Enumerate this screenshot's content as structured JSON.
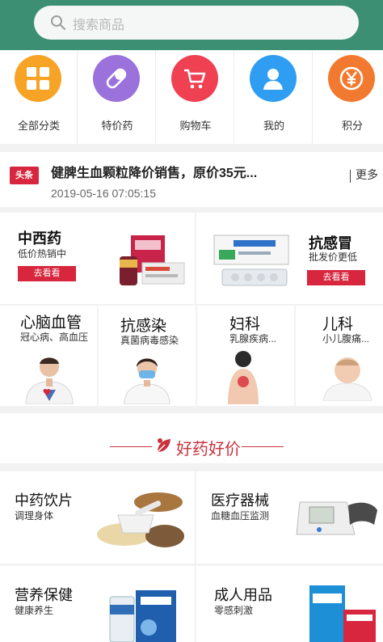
{
  "search": {
    "placeholder": "搜索商品"
  },
  "categories": [
    {
      "label": "全部分类",
      "icon": "grid-icon",
      "color": "#f7a325"
    },
    {
      "label": "特价药",
      "icon": "pill-icon",
      "color": "#9b72db"
    },
    {
      "label": "购物车",
      "icon": "cart-icon",
      "color": "#ef4152"
    },
    {
      "label": "我的",
      "icon": "user-icon",
      "color": "#2f9df2"
    },
    {
      "label": "积分",
      "icon": "yen-coin-icon",
      "color": "#f17a30"
    }
  ],
  "news": {
    "badge": "头条",
    "title": "健脾生血颗粒降价销售，原价35元...",
    "time": "2019-05-16 07:05:15",
    "more": "更多"
  },
  "featured": [
    {
      "title": "中西药",
      "subtitle": "低价热销中",
      "button": "去看看"
    },
    {
      "title": "抗感冒",
      "subtitle": "批发价更低",
      "button": "去看看"
    }
  ],
  "departments": [
    {
      "title": "心脑血管",
      "subtitle": "冠心病、高血压"
    },
    {
      "title": "抗感染",
      "subtitle": "真菌病毒感染"
    },
    {
      "title": "妇科",
      "subtitle": "乳腺疾病..."
    },
    {
      "title": "儿科",
      "subtitle": "小儿腹痛..."
    }
  ],
  "section_banner": {
    "title": "好药好价",
    "icon": "medicine-leaf-icon",
    "color": "#c8323c"
  },
  "products": [
    {
      "title": "中药饮片",
      "subtitle": "调理身体"
    },
    {
      "title": "医疗器械",
      "subtitle": "血糖血压监测"
    },
    {
      "title": "营养保健",
      "subtitle": "健康养生"
    },
    {
      "title": "成人用品",
      "subtitle": "零感刺激"
    }
  ]
}
